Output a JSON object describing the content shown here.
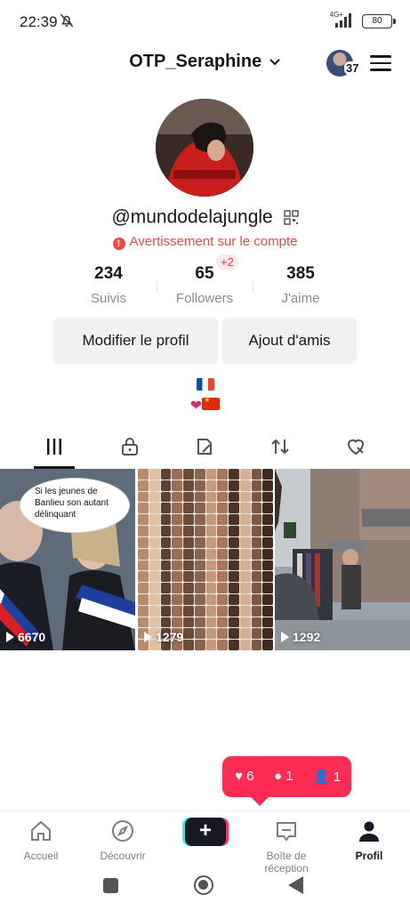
{
  "status_bar": {
    "time": "22:39",
    "network": "4G+",
    "battery": "80"
  },
  "header": {
    "username": "OTP_Seraphine",
    "notif_badge": "37"
  },
  "profile": {
    "handle": "@mundodelajungle",
    "warning": "Avertissement sur le compte",
    "stats": [
      {
        "value": "234",
        "label": "Suivis"
      },
      {
        "value": "65",
        "label": "Followers",
        "badge": "+2"
      },
      {
        "value": "385",
        "label": "J'aime"
      }
    ],
    "edit_button": "Modifier le profil",
    "add_friends_button": "Ajout d'amis"
  },
  "tabs": [
    "videos-grid-icon",
    "lock-icon",
    "repost-icon",
    "arrows-icon",
    "liked-heart-icon"
  ],
  "videos": [
    {
      "views": "6670",
      "bubble_text": "Si les jeunes de Banlieu son autant délinquant"
    },
    {
      "views": "1279"
    },
    {
      "views": "1292"
    }
  ],
  "notification": {
    "likes": "6",
    "comments": "1",
    "followers": "1"
  },
  "bottom_nav": [
    {
      "label": "Accueil",
      "icon": "home-icon"
    },
    {
      "label": "Découvrir",
      "icon": "compass-icon"
    },
    {
      "label": "",
      "icon": "plus-icon"
    },
    {
      "label": "Boîte de réception",
      "icon": "inbox-icon"
    },
    {
      "label": "Profil",
      "icon": "profile-icon"
    }
  ],
  "colors": {
    "accent": "#fe2c55",
    "warning": "#e54d42",
    "cyan": "#25f4ee"
  }
}
